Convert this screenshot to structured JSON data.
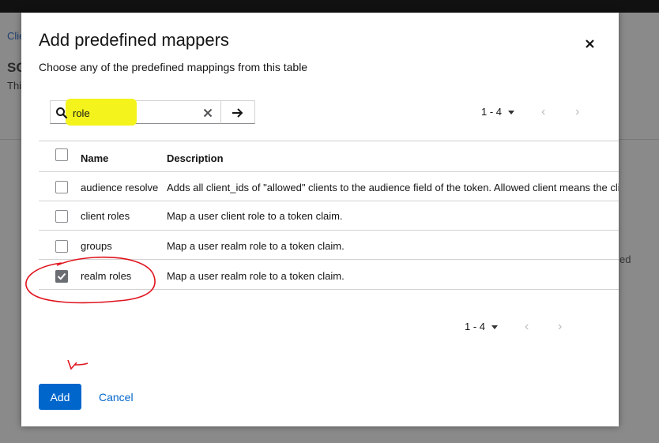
{
  "background": {
    "breadcrumb_link": "Clie",
    "heading": "SC",
    "subtext": "Thi",
    "right_fragment": "ed"
  },
  "modal": {
    "title": "Add predefined mappers",
    "subtitle": "Choose any of the predefined mappings from this table",
    "close_icon": "close-icon"
  },
  "search": {
    "value": "role",
    "icon": "search-icon",
    "clear_icon": "clear-icon",
    "go_icon": "arrow-right-icon",
    "highlight_color": "#f4f31c"
  },
  "pagination_top": {
    "range": "1 - 4"
  },
  "pagination_bottom": {
    "range": "1 - 4"
  },
  "table": {
    "headers": {
      "name": "Name",
      "description": "Description"
    },
    "rows": [
      {
        "name": "audience resolve",
        "description": "Adds all client_ids of \"allowed\" clients to the audience field of the token. Allowed client means the client",
        "checked": false
      },
      {
        "name": "client roles",
        "description": "Map a user client role to a token claim.",
        "checked": false
      },
      {
        "name": "groups",
        "description": "Map a user realm role to a token claim.",
        "checked": false
      },
      {
        "name": "realm roles",
        "description": "Map a user realm role to a token claim.",
        "checked": true
      }
    ]
  },
  "actions": {
    "add_label": "Add",
    "cancel_label": "Cancel"
  },
  "colors": {
    "primary": "#0066cc",
    "annotation": "#e0141e"
  }
}
